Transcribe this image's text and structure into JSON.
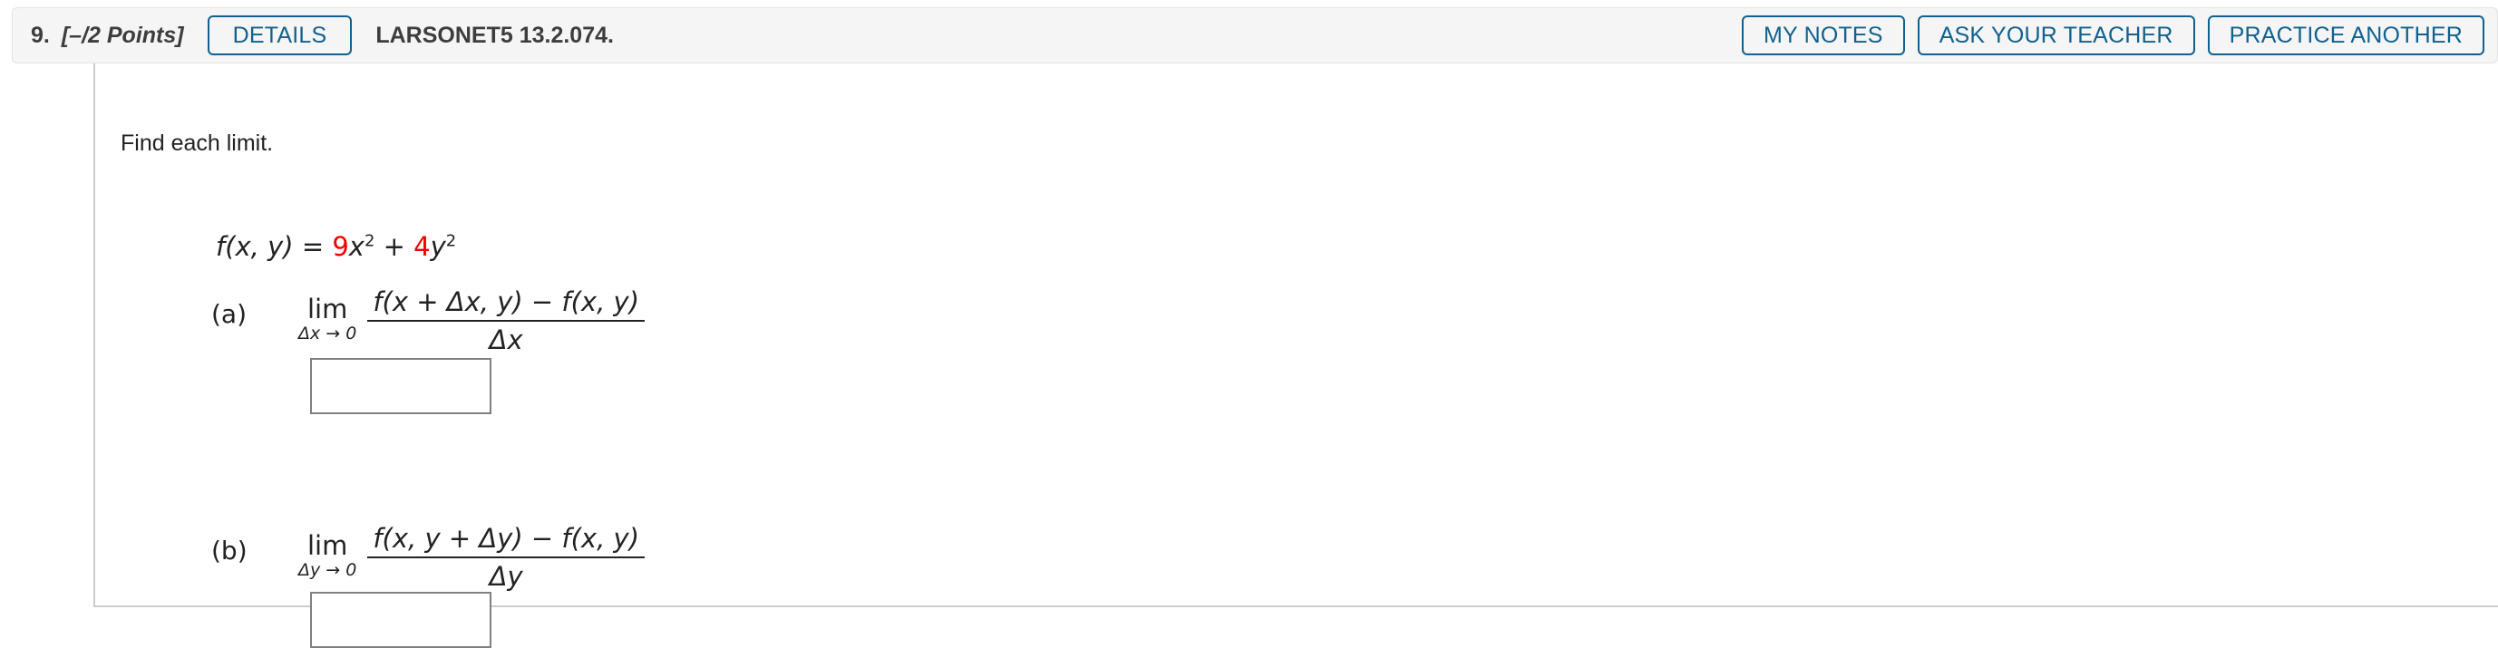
{
  "header": {
    "question_number": "9.",
    "points": "[–/2 Points]",
    "details_label": "DETAILS",
    "assignment_title": "LARSONET5 13.2.074.",
    "my_notes_label": "MY NOTES",
    "ask_teacher_label": "ASK YOUR TEACHER",
    "practice_another_label": "PRACTICE ANOTHER",
    "accent_color": "#10618f",
    "background_color": "#f5f5f5"
  },
  "content": {
    "prompt": "Find each limit.",
    "function": {
      "lhs": "f(x, y) = ",
      "coef1": "9",
      "var1": "x",
      "exp1": "2",
      "plus": " + ",
      "coef2": "4",
      "var2": "y",
      "exp2": "2",
      "highlight_color": "#ee0000"
    },
    "parts": [
      {
        "label": "(a)",
        "lim_word": "lim",
        "lim_subscript": "Δx → 0",
        "numerator": "f(x + Δx, y) − f(x, y)",
        "denominator": "Δx",
        "answer_value": "",
        "answer_placeholder": ""
      },
      {
        "label": "(b)",
        "lim_word": "lim",
        "lim_subscript": "Δy → 0",
        "numerator": "f(x, y + Δy) − f(x, y)",
        "denominator": "Δy",
        "answer_value": "",
        "answer_placeholder": ""
      }
    ]
  }
}
